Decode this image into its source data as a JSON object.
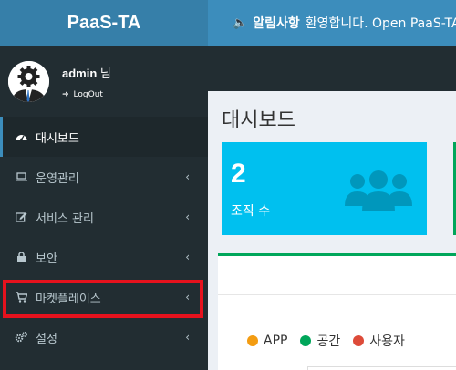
{
  "brand": "PaaS-TA",
  "notice": {
    "title": "알림사항",
    "text": "환영합니다. Open PaaS-TA"
  },
  "user": {
    "name": "admin",
    "suffix": "님",
    "logout_label": "LogOut"
  },
  "sidebar": {
    "items": [
      {
        "label": "대시보드",
        "icon": "dashboard-icon"
      },
      {
        "label": "운영관리",
        "icon": "laptop-icon"
      },
      {
        "label": "서비스 관리",
        "icon": "edit-icon"
      },
      {
        "label": "보안",
        "icon": "lock-icon"
      },
      {
        "label": "마켓플레이스",
        "icon": "cart-icon"
      },
      {
        "label": "설정",
        "icon": "gears-icon"
      }
    ]
  },
  "page": {
    "title": "대시보드"
  },
  "info_box": {
    "count": "2",
    "label": "조직 수",
    "icon": "users-icon",
    "color": "#00c0ef"
  },
  "legend": [
    {
      "label": "APP",
      "color": "#f39c12"
    },
    {
      "label": "공간",
      "color": "#00a65a"
    },
    {
      "label": "사용자",
      "color": "#dd4b39"
    }
  ],
  "colors": {
    "header": "#3c8dbc",
    "brand_bg": "#367fa9",
    "sidebar": "#222d32",
    "highlight": "#e6121d"
  }
}
